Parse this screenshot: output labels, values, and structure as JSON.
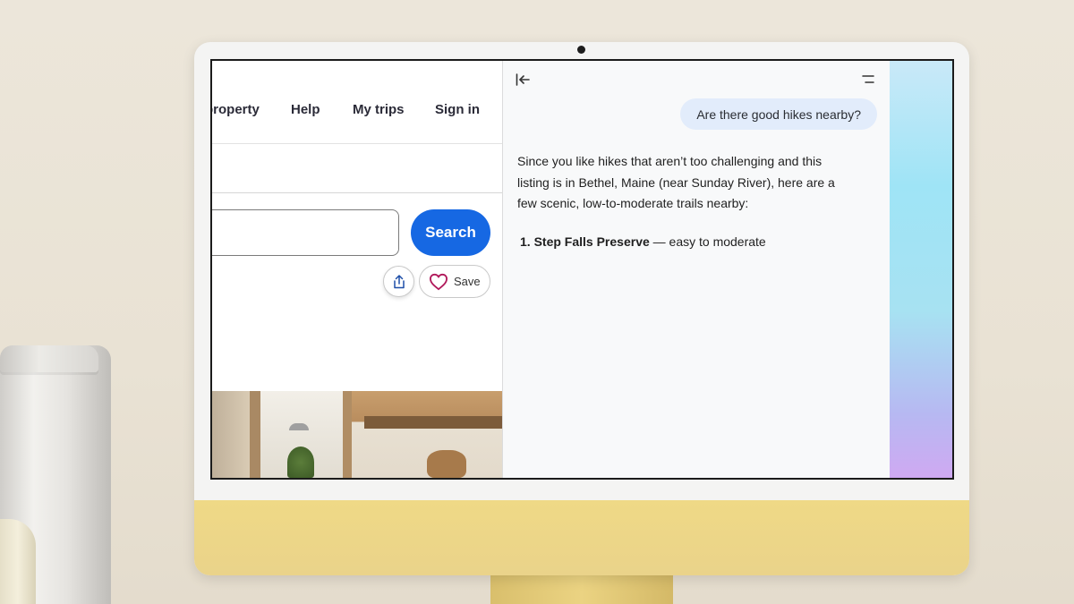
{
  "colors": {
    "primary_button": "#1668e3",
    "user_bubble": "#e2ecfb",
    "heart": "#b0185a",
    "monitor_chin": "#ead38a"
  },
  "site": {
    "nav": {
      "list_property": "property",
      "help": "Help",
      "my_trips": "My trips",
      "sign_in": "Sign in"
    },
    "search": {
      "placeholder": "",
      "button_label": "Search"
    },
    "actions": {
      "share_icon": "share-icon",
      "save_icon": "heart-icon",
      "save_label": "Save"
    }
  },
  "chat": {
    "collapse_icon": "collapse-left-icon",
    "menu_icon": "menu-icon",
    "user_message": "Are there good hikes nearby?",
    "answer_intro": "Since you like hikes that aren’t too challenging and this listing is in Bethel, Maine (near Sunday River), here are a few scenic, low-to-moderate trails nearby:",
    "items": [
      {
        "number": "1.",
        "title": "Step Falls Preserve",
        "detail": " — easy to moderate"
      }
    ]
  }
}
